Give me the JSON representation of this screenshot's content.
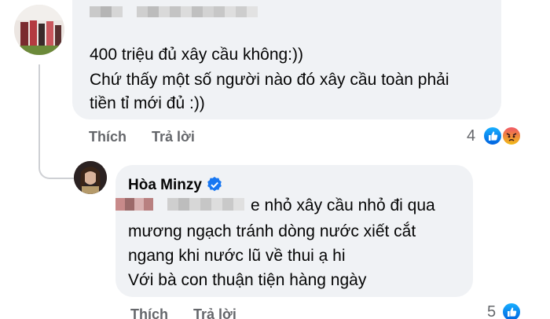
{
  "comment1": {
    "lines": [
      "400 triệu đủ xây cầu không:))",
      "Chứ thấy một số người nào đó xây cầu toàn phải",
      "tiền tỉ mới đủ :))"
    ],
    "like_label": "Thích",
    "reply_label": "Trả lời",
    "reaction_count": "4",
    "reactions": [
      "like-icon",
      "angry-icon"
    ]
  },
  "reply": {
    "author": "Hòa Minzy",
    "verified_icon": "verified-badge-icon",
    "lines": [
      "e nhỏ xây cầu nhỏ đi qua",
      "mương ngạch tránh dòng nước xiết cắt",
      "ngang khi nước lũ về thui ạ hi",
      "Với bà con thuận tiện hàng ngày"
    ],
    "like_label": "Thích",
    "reply_label": "Trả lời",
    "reaction_count": "5",
    "reactions": [
      "like-icon"
    ]
  },
  "colors": {
    "bubble": "#f0f2f5",
    "meta": "#65676b",
    "verified": "#1877f2"
  }
}
